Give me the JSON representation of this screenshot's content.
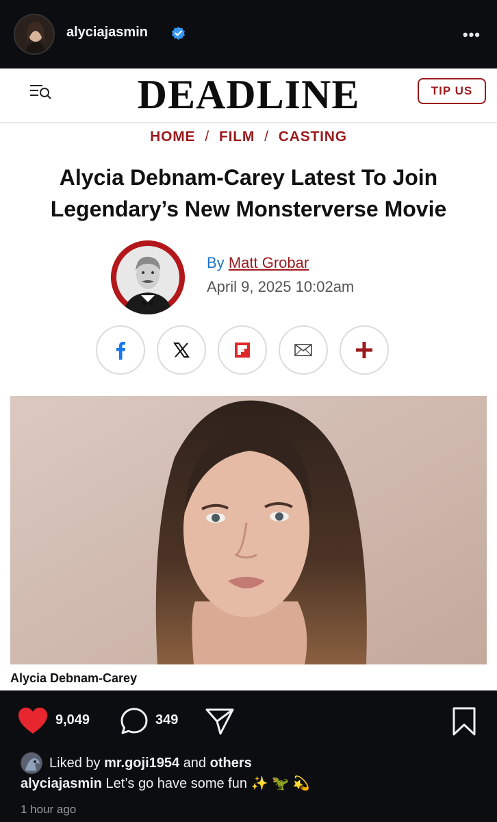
{
  "post_header": {
    "username": "alyciajasmin",
    "more_label": "•••"
  },
  "deadline": {
    "logo": "DEADLINE",
    "tip_button": "TIP US",
    "breadcrumb": [
      "HOME",
      "FILM",
      "CASTING"
    ],
    "breadcrumb_separator": "/",
    "headline": "Alycia Debnam-Carey Latest To Join Legendary’s New Monsterverse Movie",
    "by_label": "By",
    "author": "Matt Grobar",
    "date": "April 9, 2025 10:02am",
    "share_icons": [
      "facebook-icon",
      "x-icon",
      "flipboard-icon",
      "email-icon",
      "plus-icon"
    ],
    "photo_caption": "Alycia Debnam-Carey"
  },
  "actions": {
    "likes": "9,049",
    "comments": "349"
  },
  "footer": {
    "liked_prefix": "Liked by",
    "liked_user": "mr.goji1954",
    "liked_and": "and",
    "liked_others": "others",
    "caption_user": "alyciajasmin",
    "caption_text": "Let’s go have some fun ✨ 🦖 💫",
    "time_ago": "1 hour ago"
  },
  "colors": {
    "deadline_red": "#9c1a1d",
    "link_blue": "#1a73c8",
    "heart_red": "#e8262f",
    "verified_blue": "#3797f0"
  }
}
